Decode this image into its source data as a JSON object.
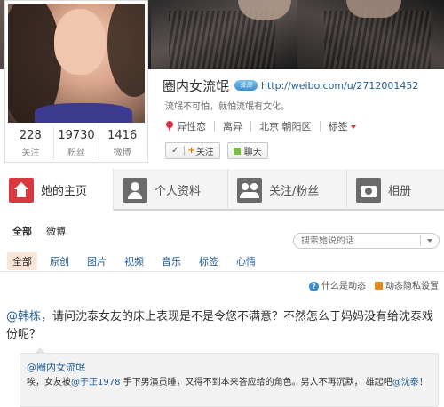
{
  "profile": {
    "name": "圈内女流氓",
    "badge": "会员",
    "url": "http://weibo.com/u/2712001452",
    "bio": "流氓不可怕，就怕流氓有文化。",
    "stats": [
      {
        "num": "228",
        "label": "关注"
      },
      {
        "num": "19730",
        "label": "粉丝"
      },
      {
        "num": "1416",
        "label": "微博"
      }
    ],
    "tags": [
      "异性恋",
      "离异",
      "北京 朝阳区"
    ],
    "tags_more": "标签",
    "follow_label": "关注",
    "chat_label": "聊天"
  },
  "tabs": [
    {
      "label": "她的主页",
      "icon": "home-icon"
    },
    {
      "label": "个人资料",
      "icon": "person-icon"
    },
    {
      "label": "关注/粉丝",
      "icon": "people-icon"
    },
    {
      "label": "相册",
      "icon": "camera-icon"
    }
  ],
  "subtabs": [
    "全部",
    "微博"
  ],
  "search": {
    "placeholder": "搜索她说的话"
  },
  "filters": [
    "全部",
    "原创",
    "图片",
    "视频",
    "音乐",
    "标签",
    "心情"
  ],
  "help": {
    "what_is": "什么是动态",
    "privacy": "动态隐私设置"
  },
  "post": {
    "mention": "@韩栋",
    "text": "，请问沈泰女友的床上表现是不是令您不满意？不然怎么于妈妈没有给沈泰戏份呢？"
  },
  "repost": {
    "author": "@圈内女流氓",
    "text_1": "唉，女友被",
    "mention_1": "@于正1978",
    "text_2": " 手下男演员睡，又得不到本来答应给的角色。男人不再沉默， 雄起吧",
    "mention_2": "@沈泰",
    "text_3": "！"
  },
  "colors": {
    "accent_red": "#d9383e",
    "link_blue": "#1f5c94",
    "follow_orange": "#e67300",
    "chat_green": "#7ac142"
  }
}
